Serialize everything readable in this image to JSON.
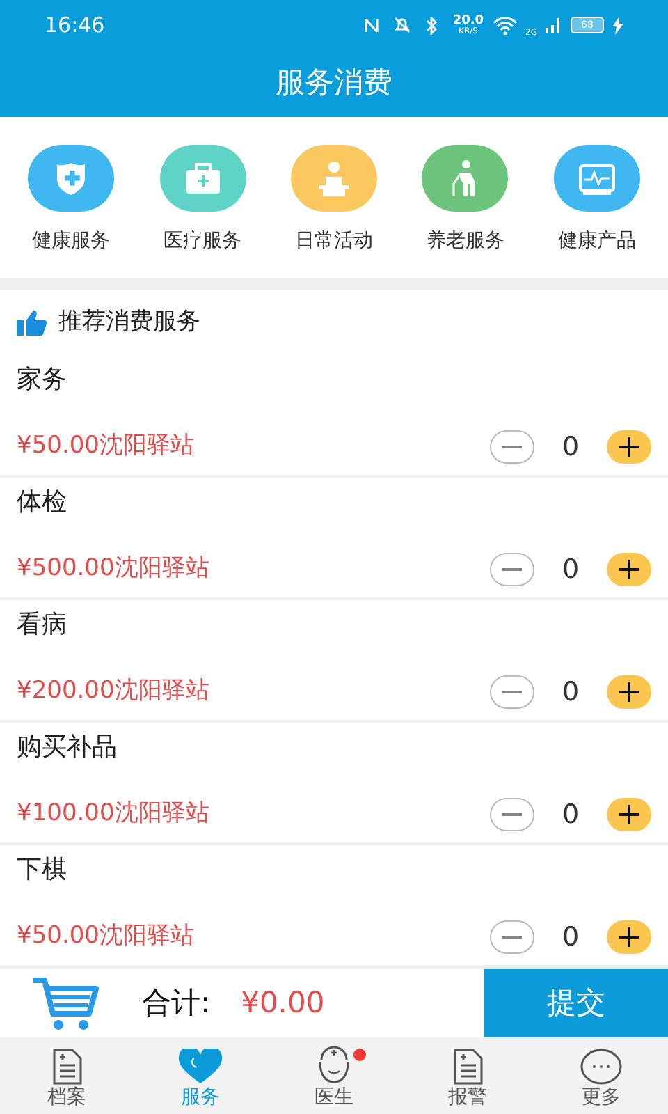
{
  "status_bar": {
    "time": "16:46",
    "net_speed": "20.0",
    "net_unit": "KB/S",
    "network": "2G",
    "battery": "68"
  },
  "header": {
    "title": "服务消费"
  },
  "categories": [
    {
      "label": "健康服务",
      "color": "#3fb8f2"
    },
    {
      "label": "医疗服务",
      "color": "#5fd3c6"
    },
    {
      "label": "日常活动",
      "color": "#fbc860"
    },
    {
      "label": "养老服务",
      "color": "#6dc57d"
    },
    {
      "label": "健康产品",
      "color": "#3fb8f2"
    }
  ],
  "section": {
    "title": "推荐消费服务"
  },
  "items": [
    {
      "name": "家务",
      "price": "¥50.00沈阳驿站",
      "quantity": "0"
    },
    {
      "name": "体检",
      "price": "¥500.00沈阳驿站",
      "quantity": "0"
    },
    {
      "name": "看病",
      "price": "¥200.00沈阳驿站",
      "quantity": "0"
    },
    {
      "name": "购买补品",
      "price": "¥100.00沈阳驿站",
      "quantity": "0"
    },
    {
      "name": "下棋",
      "price": "¥50.00沈阳驿站",
      "quantity": "0"
    }
  ],
  "cart": {
    "total_label": "合计:",
    "total": "¥0.00",
    "submit": "提交"
  },
  "tabs": [
    {
      "label": "档案",
      "selected": false,
      "badge": false
    },
    {
      "label": "服务",
      "selected": true,
      "badge": false
    },
    {
      "label": "医生",
      "selected": false,
      "badge": true
    },
    {
      "label": "报警",
      "selected": false,
      "badge": false
    },
    {
      "label": "更多",
      "selected": false,
      "badge": false
    }
  ]
}
